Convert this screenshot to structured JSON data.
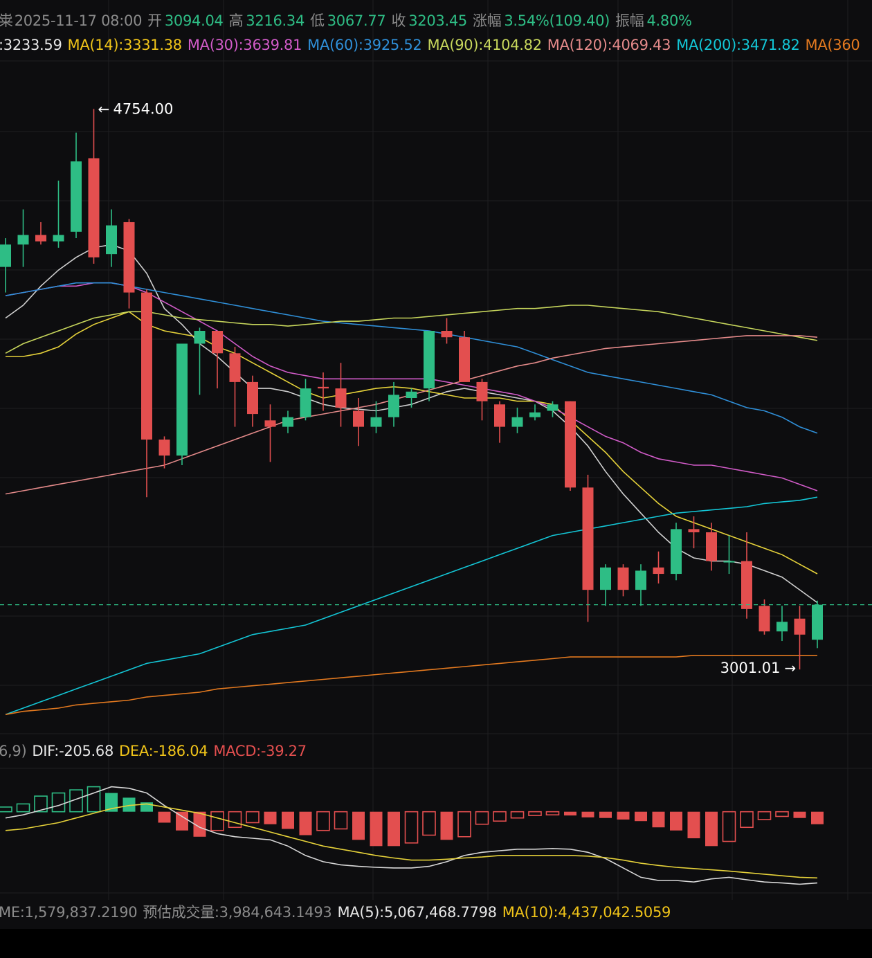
{
  "header": {
    "prefix": "粜",
    "datetime": "2025-11-17 08:00",
    "open_label": "开",
    "open": "3094.04",
    "high_label": "高",
    "high": "3216.34",
    "low_label": "低",
    "low": "3067.77",
    "close_label": "收",
    "close": "3203.45",
    "change_label": "涨幅",
    "change": "3.54%(109.40)",
    "amp_label": "振幅",
    "amp": "4.80%"
  },
  "ma_line": {
    "ma7": ":3233.59",
    "ma14": "MA(14):3331.38",
    "ma30": "MA(30):3639.81",
    "ma60": "MA(60):3925.52",
    "ma90": "MA(90):4104.82",
    "ma120": "MA(120):4069.43",
    "ma200": "MA(200):3471.82",
    "ma360": "MA(360"
  },
  "macd_line": {
    "params": "6,9)",
    "dif": "DIF:-205.68",
    "dea": "DEA:-186.04",
    "macd": "MACD:-39.27"
  },
  "volume_line": {
    "volume": "ME:1,579,837.2190",
    "est_label": "预估成交量:",
    "est": "3,984,643.1493",
    "ma5": "MA(5):5,067,468.7798",
    "ma10": "MA(10):4,437,042.5059"
  },
  "colors": {
    "up": "#2ebd85",
    "down": "#e34f4f",
    "grid": "#1e1e22",
    "bg": "#0d0d0f",
    "ma7": "#cfcfcf",
    "ma14": "#e6d23a",
    "ma30": "#d15bc8",
    "ma60": "#2f8fd8",
    "ma90": "#c7d65c",
    "ma120": "#e48a8a",
    "ma200": "#13c6d6",
    "ma360": "#e3791f",
    "dif": "#d8d8d8",
    "dea": "#e6d23a"
  },
  "chart_data": {
    "type": "candlestick",
    "ylim": [
      2800,
      4900
    ],
    "max_label": "4754.00",
    "min_label": "3001.01",
    "candles": [
      {
        "o": 4260,
        "h": 4350,
        "l": 4180,
        "c": 4330
      },
      {
        "o": 4330,
        "h": 4440,
        "l": 4260,
        "c": 4360
      },
      {
        "o": 4360,
        "h": 4400,
        "l": 4330,
        "c": 4340
      },
      {
        "o": 4340,
        "h": 4530,
        "l": 4320,
        "c": 4360
      },
      {
        "o": 4370,
        "h": 4680,
        "l": 4350,
        "c": 4590
      },
      {
        "o": 4600,
        "h": 4754,
        "l": 4270,
        "c": 4290
      },
      {
        "o": 4300,
        "h": 4440,
        "l": 4260,
        "c": 4390
      },
      {
        "o": 4400,
        "h": 4410,
        "l": 4130,
        "c": 4180
      },
      {
        "o": 4180,
        "h": 4190,
        "l": 3540,
        "c": 3720
      },
      {
        "o": 3720,
        "h": 3730,
        "l": 3630,
        "c": 3670
      },
      {
        "o": 3670,
        "h": 4020,
        "l": 3640,
        "c": 4020
      },
      {
        "o": 4020,
        "h": 4070,
        "l": 3860,
        "c": 4060
      },
      {
        "o": 4060,
        "h": 4060,
        "l": 3880,
        "c": 3990
      },
      {
        "o": 3990,
        "h": 4010,
        "l": 3760,
        "c": 3900
      },
      {
        "o": 3900,
        "h": 3920,
        "l": 3760,
        "c": 3800
      },
      {
        "o": 3780,
        "h": 3830,
        "l": 3650,
        "c": 3760
      },
      {
        "o": 3760,
        "h": 3810,
        "l": 3740,
        "c": 3790
      },
      {
        "o": 3790,
        "h": 3910,
        "l": 3780,
        "c": 3880
      },
      {
        "o": 3885,
        "h": 3930,
        "l": 3810,
        "c": 3880
      },
      {
        "o": 3880,
        "h": 3960,
        "l": 3760,
        "c": 3820
      },
      {
        "o": 3810,
        "h": 3850,
        "l": 3700,
        "c": 3760
      },
      {
        "o": 3760,
        "h": 3840,
        "l": 3740,
        "c": 3790
      },
      {
        "o": 3790,
        "h": 3900,
        "l": 3760,
        "c": 3860
      },
      {
        "o": 3850,
        "h": 3880,
        "l": 3820,
        "c": 3870
      },
      {
        "o": 3880,
        "h": 4060,
        "l": 3840,
        "c": 4060
      },
      {
        "o": 4060,
        "h": 4100,
        "l": 4020,
        "c": 4040
      },
      {
        "o": 4040,
        "h": 4060,
        "l": 3920,
        "c": 3900
      },
      {
        "o": 3900,
        "h": 3910,
        "l": 3780,
        "c": 3840
      },
      {
        "o": 3830,
        "h": 3840,
        "l": 3710,
        "c": 3760
      },
      {
        "o": 3760,
        "h": 3820,
        "l": 3740,
        "c": 3790
      },
      {
        "o": 3790,
        "h": 3830,
        "l": 3780,
        "c": 3805
      },
      {
        "o": 3810,
        "h": 3840,
        "l": 3790,
        "c": 3830
      },
      {
        "o": 3840,
        "h": 3840,
        "l": 3560,
        "c": 3570
      },
      {
        "o": 3570,
        "h": 3610,
        "l": 3150,
        "c": 3250
      },
      {
        "o": 3250,
        "h": 3330,
        "l": 3200,
        "c": 3320
      },
      {
        "o": 3320,
        "h": 3330,
        "l": 3230,
        "c": 3250
      },
      {
        "o": 3250,
        "h": 3330,
        "l": 3200,
        "c": 3310
      },
      {
        "o": 3320,
        "h": 3370,
        "l": 3270,
        "c": 3300
      },
      {
        "o": 3300,
        "h": 3460,
        "l": 3280,
        "c": 3440
      },
      {
        "o": 3440,
        "h": 3480,
        "l": 3380,
        "c": 3430
      },
      {
        "o": 3430,
        "h": 3460,
        "l": 3310,
        "c": 3340
      },
      {
        "o": 3340,
        "h": 3420,
        "l": 3300,
        "c": 3340
      },
      {
        "o": 3340,
        "h": 3430,
        "l": 3160,
        "c": 3190
      },
      {
        "o": 3200,
        "h": 3220,
        "l": 3110,
        "c": 3120
      },
      {
        "o": 3120,
        "h": 3200,
        "l": 3090,
        "c": 3150
      },
      {
        "o": 3160,
        "h": 3200,
        "l": 3001.01,
        "c": 3110
      },
      {
        "o": 3094.04,
        "h": 3216.34,
        "l": 3067.77,
        "c": 3203.45
      }
    ],
    "ma_series": {
      "ma7": [
        4100,
        4140,
        4200,
        4250,
        4290,
        4320,
        4330,
        4310,
        4240,
        4130,
        4080,
        4020,
        3980,
        3930,
        3880,
        3880,
        3870,
        3850,
        3830,
        3820,
        3815,
        3810,
        3820,
        3830,
        3850,
        3870,
        3880,
        3870,
        3860,
        3850,
        3840,
        3810,
        3760,
        3700,
        3620,
        3550,
        3490,
        3430,
        3380,
        3350,
        3340,
        3340,
        3330,
        3310,
        3290,
        3250,
        3210
      ],
      "ma14": [
        3980,
        3980,
        3990,
        4010,
        4050,
        4080,
        4100,
        4120,
        4080,
        4060,
        4050,
        4040,
        4010,
        3990,
        3960,
        3930,
        3900,
        3870,
        3850,
        3860,
        3870,
        3880,
        3885,
        3880,
        3870,
        3860,
        3850,
        3850,
        3850,
        3840,
        3840,
        3830,
        3780,
        3730,
        3680,
        3620,
        3570,
        3520,
        3480,
        3460,
        3440,
        3420,
        3400,
        3380,
        3360,
        3330,
        3300
      ],
      "ma30": [
        4170,
        4180,
        4190,
        4200,
        4200,
        4210,
        4210,
        4200,
        4180,
        4150,
        4120,
        4090,
        4060,
        4020,
        3980,
        3950,
        3930,
        3920,
        3910,
        3910,
        3910,
        3910,
        3910,
        3910,
        3910,
        3900,
        3890,
        3880,
        3870,
        3860,
        3840,
        3820,
        3790,
        3760,
        3730,
        3710,
        3680,
        3660,
        3650,
        3640,
        3640,
        3630,
        3620,
        3610,
        3600,
        3580,
        3560
      ],
      "ma60": [
        4170,
        4180,
        4190,
        4200,
        4210,
        4210,
        4210,
        4200,
        4190,
        4180,
        4170,
        4160,
        4150,
        4140,
        4130,
        4120,
        4110,
        4100,
        4090,
        4085,
        4080,
        4075,
        4070,
        4065,
        4060,
        4050,
        4040,
        4030,
        4020,
        4010,
        3990,
        3970,
        3950,
        3930,
        3920,
        3910,
        3900,
        3890,
        3880,
        3870,
        3860,
        3840,
        3820,
        3810,
        3790,
        3760,
        3740
      ],
      "ma90": [
        3990,
        4020,
        4040,
        4060,
        4080,
        4100,
        4110,
        4120,
        4120,
        4110,
        4100,
        4095,
        4090,
        4085,
        4080,
        4080,
        4075,
        4080,
        4085,
        4090,
        4090,
        4095,
        4100,
        4100,
        4105,
        4110,
        4115,
        4120,
        4125,
        4130,
        4130,
        4135,
        4140,
        4140,
        4135,
        4130,
        4125,
        4120,
        4110,
        4100,
        4090,
        4080,
        4070,
        4060,
        4050,
        4040,
        4030
      ],
      "ma120": [
        3550,
        3560,
        3570,
        3580,
        3590,
        3600,
        3610,
        3620,
        3630,
        3640,
        3660,
        3680,
        3700,
        3720,
        3740,
        3760,
        3780,
        3790,
        3800,
        3810,
        3820,
        3830,
        3845,
        3860,
        3875,
        3890,
        3905,
        3920,
        3935,
        3950,
        3960,
        3975,
        3985,
        3995,
        4005,
        4010,
        4015,
        4020,
        4025,
        4030,
        4035,
        4040,
        4045,
        4045,
        4045,
        4045,
        4040
      ],
      "ma200": [
        2860,
        2880,
        2900,
        2920,
        2940,
        2960,
        2980,
        3000,
        3020,
        3030,
        3040,
        3050,
        3070,
        3090,
        3110,
        3120,
        3130,
        3140,
        3160,
        3180,
        3200,
        3220,
        3240,
        3260,
        3280,
        3300,
        3320,
        3340,
        3360,
        3380,
        3400,
        3420,
        3430,
        3440,
        3450,
        3460,
        3470,
        3480,
        3490,
        3495,
        3500,
        3505,
        3510,
        3520,
        3525,
        3530,
        3540
      ],
      "ma360": [
        2860,
        2870,
        2875,
        2880,
        2890,
        2895,
        2900,
        2905,
        2915,
        2920,
        2925,
        2930,
        2940,
        2945,
        2950,
        2955,
        2960,
        2965,
        2970,
        2975,
        2980,
        2985,
        2990,
        2995,
        3000,
        3005,
        3010,
        3015,
        3020,
        3025,
        3030,
        3035,
        3040,
        3040,
        3040,
        3040,
        3040,
        3040,
        3040,
        3045,
        3045,
        3045,
        3045,
        3045,
        3045,
        3045,
        3045
      ]
    },
    "macd": {
      "ylim": [
        -260,
        150
      ],
      "hist": [
        15,
        25,
        50,
        60,
        70,
        80,
        60,
        45,
        30,
        -35,
        -60,
        -80,
        -60,
        -50,
        -35,
        -40,
        -55,
        -75,
        -60,
        -55,
        -90,
        -110,
        -110,
        -100,
        -75,
        -90,
        -80,
        -40,
        -30,
        -20,
        -12,
        -10,
        -12,
        -18,
        -20,
        -25,
        -30,
        -50,
        -60,
        -85,
        -110,
        -95,
        -50,
        -25,
        -15,
        -20,
        -40
      ],
      "dif": [
        -20,
        -10,
        5,
        20,
        40,
        60,
        80,
        75,
        60,
        20,
        -15,
        -50,
        -70,
        -80,
        -85,
        -90,
        -110,
        -140,
        -160,
        -170,
        -175,
        -178,
        -180,
        -180,
        -175,
        -160,
        -140,
        -130,
        -125,
        -120,
        -120,
        -118,
        -120,
        -130,
        -150,
        -180,
        -210,
        -220,
        -220,
        -225,
        -215,
        -210,
        -218,
        -225,
        -228,
        -232,
        -228
      ],
      "dea": [
        -60,
        -55,
        -45,
        -35,
        -20,
        -5,
        10,
        20,
        25,
        15,
        5,
        -5,
        -20,
        -35,
        -50,
        -65,
        -80,
        -95,
        -110,
        -120,
        -130,
        -140,
        -148,
        -155,
        -155,
        -152,
        -148,
        -145,
        -140,
        -140,
        -140,
        -140,
        -140,
        -142,
        -147,
        -155,
        -165,
        -172,
        -178,
        -182,
        -186,
        -190,
        -195,
        -200,
        -205,
        -210,
        -212
      ]
    }
  }
}
